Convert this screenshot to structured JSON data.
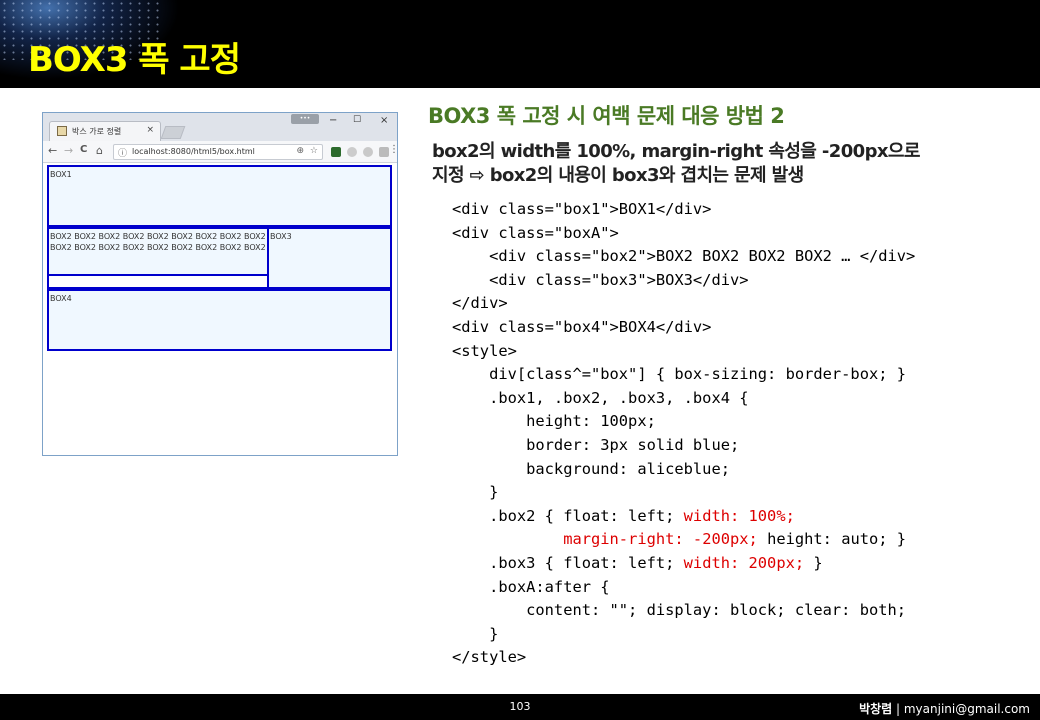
{
  "slide": {
    "title": "BOX3 폭 고정",
    "heading": "BOX3 폭 고정 시 여백 문제 대응 방법 2",
    "desc_line1": "box2의 width를 100%, margin-right 속성을 -200px으로",
    "desc_line2": "지정 ⇨ box2의 내용이 box3와 겹치는 문제 발생",
    "page_number": "103",
    "author_name": "박창렴",
    "author_email": " | myanjini@gmail.com"
  },
  "browser": {
    "tab_title": "박스 가로 정렬",
    "tab_close": "×",
    "url": "localhost:8080/html5/box.html",
    "min_label": "−",
    "max_label": "☐",
    "close_label": "×",
    "back": "←",
    "forward": "→",
    "reload": "C",
    "home": "⌂",
    "menu": "⋮",
    "demo": {
      "box1": "BOX1",
      "box2": "BOX2 BOX2 BOX2 BOX2 BOX2 BOX2 BOX2 BOX2 BOX2 BOX2 BOX2 BOX2 BOX2 BOX2 BOX2 BOX2 BOX2 BOX2",
      "box3": "BOX3",
      "box4": "BOX4"
    },
    "colors": {
      "border": "#0000cc",
      "fill": "#f0f8ff"
    }
  },
  "code": {
    "l1": "<div class=\"box1\">BOX1</div>",
    "l2": "<div class=\"boxA\">",
    "l3": "    <div class=\"box2\">BOX2 BOX2 BOX2 BOX2 … </div>",
    "l4": "    <div class=\"box3\">BOX3</div>",
    "l5": "</div>",
    "l6": "<div class=\"box4\">BOX4</div>",
    "l7": "<style>",
    "l8": "    div[class^=\"box\"] { box-sizing: border-box; }",
    "l9": "    .box1, .box2, .box3, .box4 {",
    "l10": "        height: 100px;",
    "l11": "        border: 3px solid blue;",
    "l12": "        background: aliceblue;",
    "l13": "    }",
    "l14a": "    .box2 { float: left; ",
    "l14b": "width: 100%;",
    "l15a": "            ",
    "l15b": "margin-right: -200px;",
    "l15c": " height: auto; }",
    "l16a": "    .box3 { float: left; ",
    "l16b": "width: 200px;",
    "l16c": " }",
    "l17": "    .boxA:after {",
    "l18": "        content: \"\"; display: block; clear: both;",
    "l19": "    }",
    "l20": "</style>"
  },
  "colors": {
    "title": "#ffff00",
    "heading": "#4a7a25",
    "highlight": "#dd0000"
  }
}
